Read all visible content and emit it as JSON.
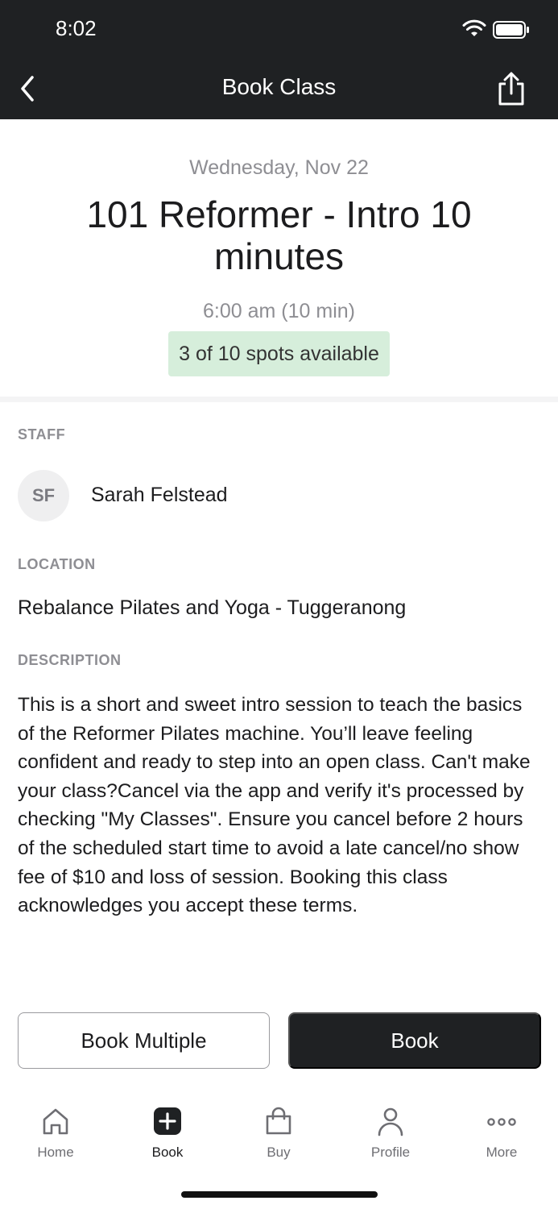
{
  "status_bar": {
    "time": "8:02"
  },
  "nav": {
    "title": "Book Class"
  },
  "class": {
    "date": "Wednesday, Nov 22",
    "title": "101 Reformer - Intro 10 minutes",
    "time": "6:00 am (10 min)",
    "spots": "3 of 10 spots available"
  },
  "staff": {
    "label": "STAFF",
    "initials": "SF",
    "name": "Sarah Felstead"
  },
  "location": {
    "label": "LOCATION",
    "name": "Rebalance Pilates and Yoga - Tuggeranong"
  },
  "description": {
    "label": "DESCRIPTION",
    "text": "This is a short and sweet intro session to teach the basics of the Reformer Pilates machine. You’ll leave feeling confident and ready to step into an open class.  Can't make your class?Cancel via the app and verify it's processed by checking \"My Classes\". Ensure you cancel before 2 hours of the scheduled start time to avoid a late cancel/no show fee of $10 and loss of session. Booking this class acknowledges you accept these terms."
  },
  "actions": {
    "book_multiple": "Book Multiple",
    "book": "Book"
  },
  "tabs": [
    {
      "label": "Home",
      "icon": "home-icon"
    },
    {
      "label": "Book",
      "icon": "plus-square-icon",
      "active": true
    },
    {
      "label": "Buy",
      "icon": "shopping-bag-icon"
    },
    {
      "label": "Profile",
      "icon": "person-icon"
    },
    {
      "label": "More",
      "icon": "more-dots-icon"
    }
  ],
  "colors": {
    "header_bg": "#1f2123",
    "spots_bg": "#d6eedb",
    "muted_text": "#8e8e93"
  }
}
